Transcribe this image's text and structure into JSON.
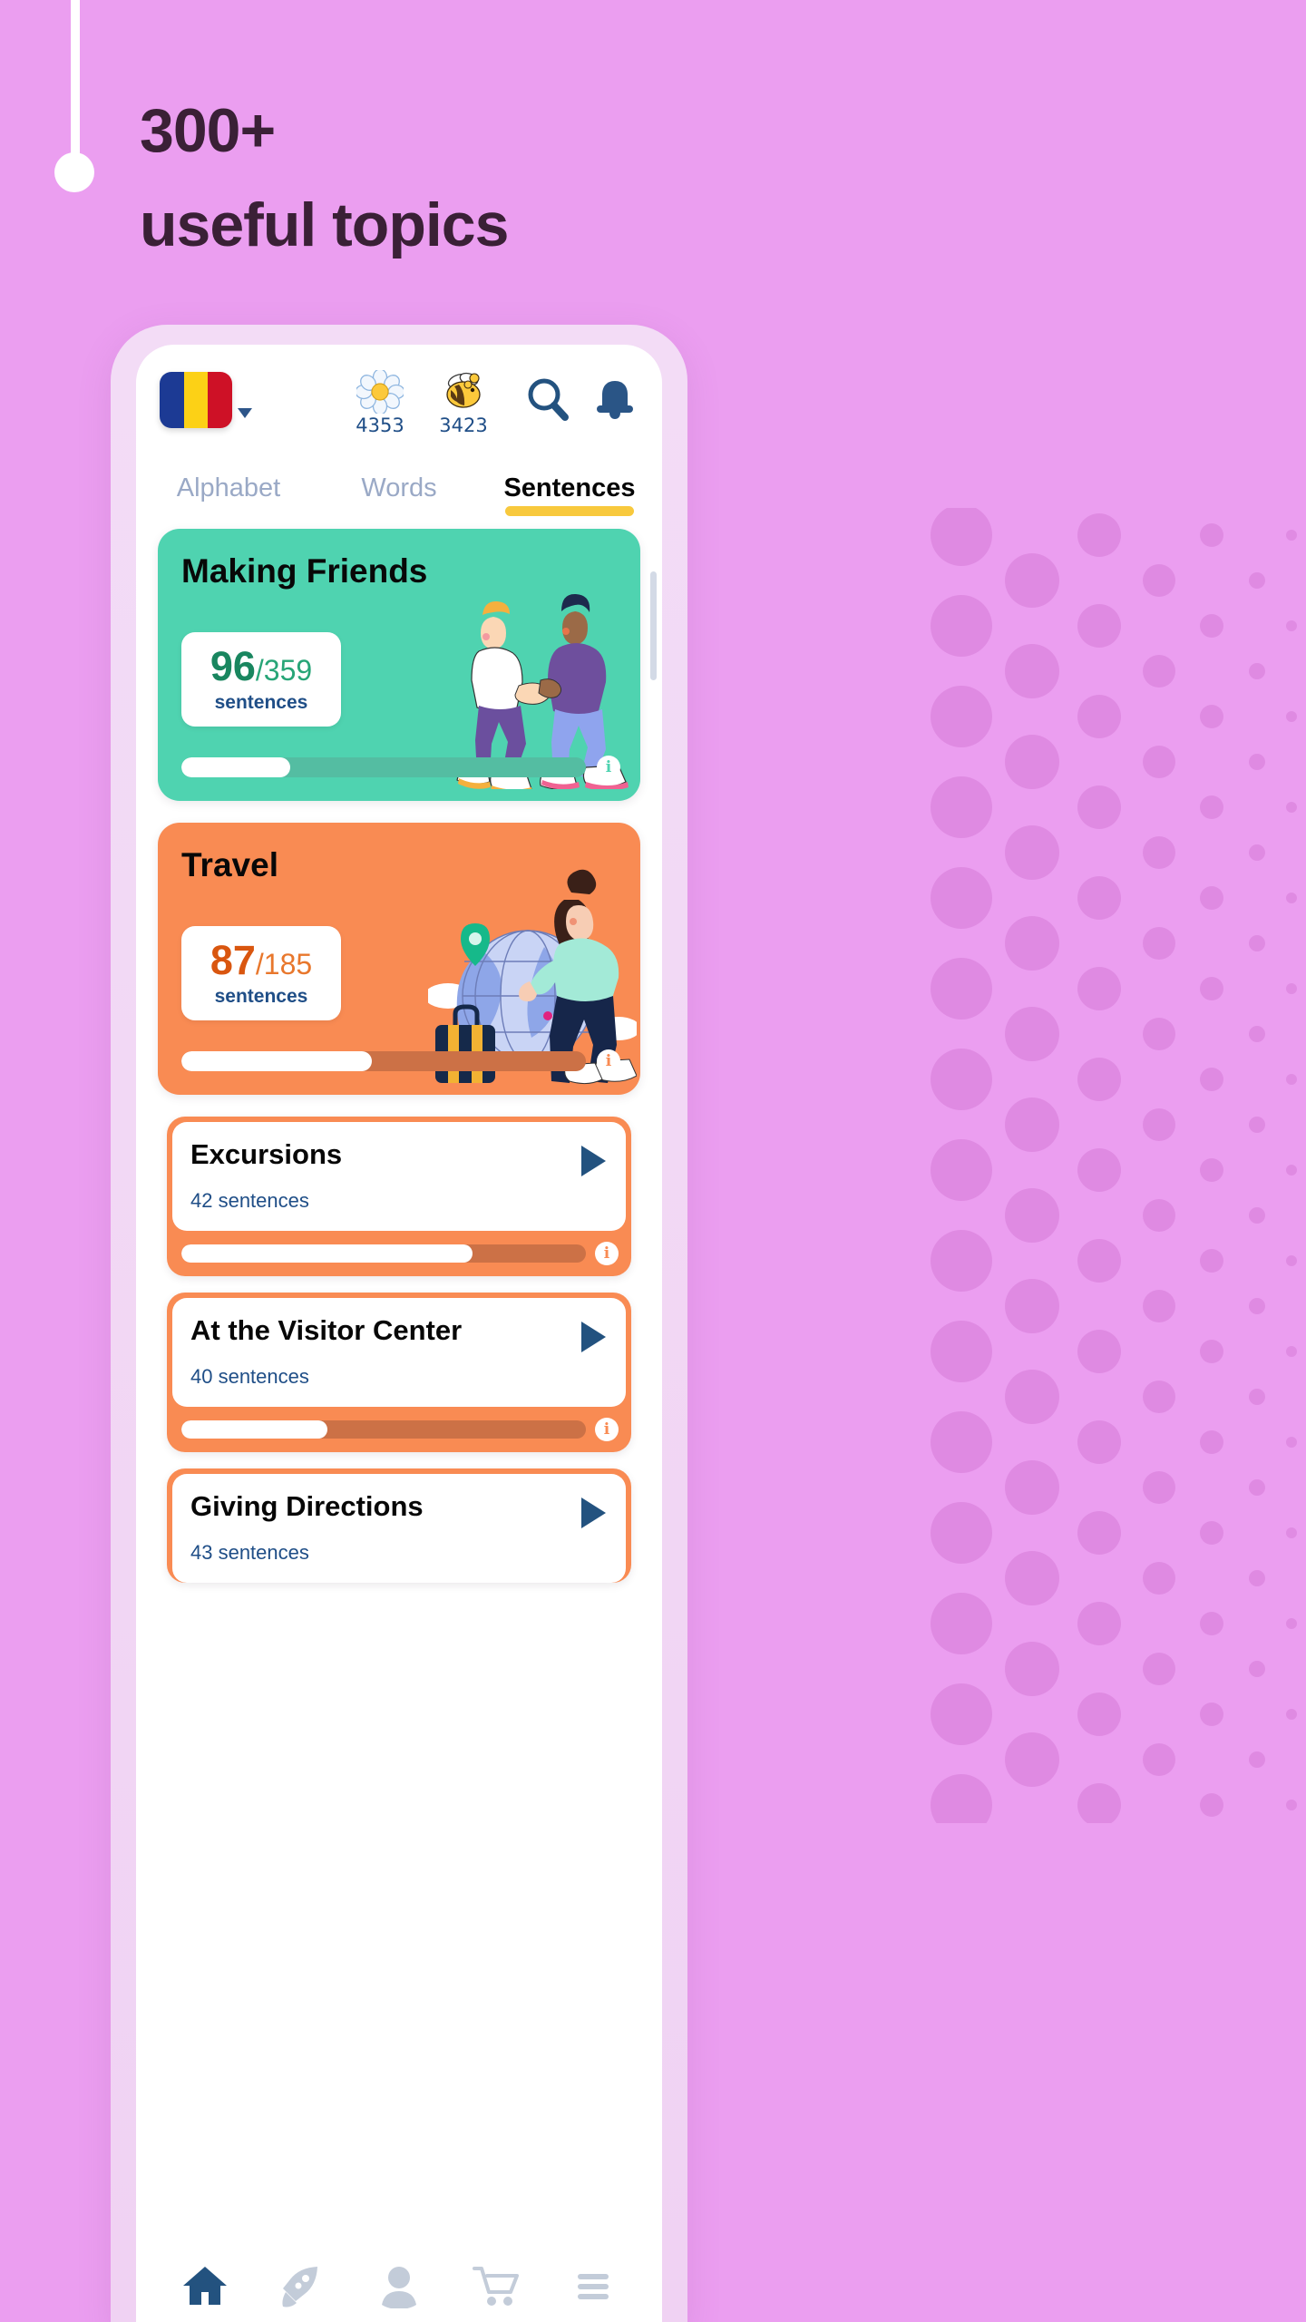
{
  "promo": {
    "headline_line1": "300+",
    "headline_line2": "useful topics",
    "background_color": "#eb9ef0",
    "headline_color": "#3a2036"
  },
  "app": {
    "header": {
      "flag": {
        "name": "romania-flag",
        "stripes": [
          "#1c3a94",
          "#fcd116",
          "#ce1126"
        ]
      },
      "dropdown_caret": "flag-dropdown-caret",
      "counters": [
        {
          "icon": "flower-icon",
          "value": "4353"
        },
        {
          "icon": "bee-icon",
          "value": "3423"
        }
      ],
      "actions": [
        {
          "icon": "search-icon"
        },
        {
          "icon": "bell-icon"
        }
      ]
    },
    "tabs": [
      {
        "label": "Alphabet",
        "active": false
      },
      {
        "label": "Words",
        "active": false
      },
      {
        "label": "Sentences",
        "active": true
      }
    ],
    "tab_underline_color": "#f8c93d",
    "topic_cards": [
      {
        "title": "Making Friends",
        "done": "96",
        "total": "/359",
        "unit": "sentences",
        "progress_percent": 27,
        "accent_color": "#4fd3b0",
        "illustration": "two-people-shaking-hands",
        "info_icon": "info-icon"
      },
      {
        "title": "Travel",
        "done": "87",
        "total": "/185",
        "unit": "sentences",
        "progress_percent": 47,
        "accent_color": "#f98b53",
        "illustration": "woman-with-globe-and-suitcase",
        "info_icon": "info-icon"
      }
    ],
    "subtopics": [
      {
        "title": "Excursions",
        "count": "42 sentences",
        "progress_percent": 72,
        "play_icon": "play-icon",
        "info_icon": "info-icon"
      },
      {
        "title": "At the Visitor Center",
        "count": "40 sentences",
        "progress_percent": 36,
        "play_icon": "play-icon",
        "info_icon": "info-icon"
      },
      {
        "title": "Giving Directions",
        "count": "43 sentences",
        "progress_percent": 0,
        "play_icon": "play-icon",
        "info_icon": "info-icon"
      }
    ],
    "bottom_nav": [
      {
        "icon": "home-icon",
        "active": true
      },
      {
        "icon": "rocket-icon",
        "active": false
      },
      {
        "icon": "person-icon",
        "active": false
      },
      {
        "icon": "cart-icon",
        "active": false
      },
      {
        "icon": "menu-icon",
        "active": false
      }
    ],
    "nav_active_color": "#23527f",
    "nav_inactive_color": "#c3ccd9"
  }
}
